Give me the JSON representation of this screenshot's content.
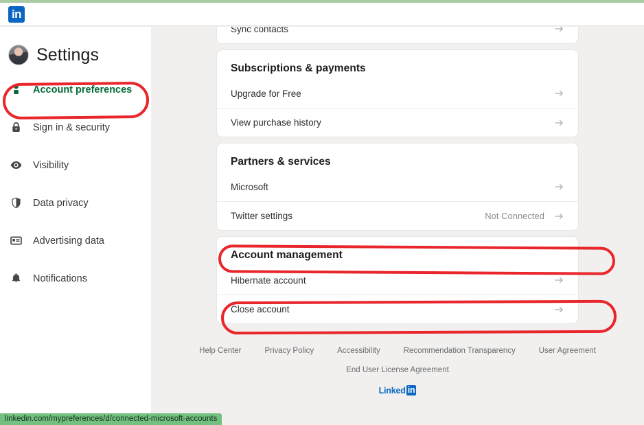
{
  "header": {
    "logo_text": "in",
    "logo_icon": "linkedin-logo-icon"
  },
  "sidebar": {
    "title": "Settings",
    "avatar_name": "user-avatar",
    "items": [
      {
        "label": "Account preferences",
        "icon": "person-icon",
        "active": true
      },
      {
        "label": "Sign in & security",
        "icon": "lock-icon",
        "active": false
      },
      {
        "label": "Visibility",
        "icon": "eye-icon",
        "active": false
      },
      {
        "label": "Data privacy",
        "icon": "shield-icon",
        "active": false
      },
      {
        "label": "Advertising data",
        "icon": "id-card-icon",
        "active": false
      },
      {
        "label": "Notifications",
        "icon": "bell-icon",
        "active": false
      }
    ]
  },
  "main": {
    "cards": [
      {
        "title": "",
        "rows": [
          {
            "label": "Sync contacts",
            "value": "",
            "arrow": true
          }
        ]
      },
      {
        "title": "Subscriptions & payments",
        "rows": [
          {
            "label": "Upgrade for Free",
            "value": "",
            "arrow": true
          },
          {
            "label": "View purchase history",
            "value": "",
            "arrow": true
          }
        ]
      },
      {
        "title": "Partners & services",
        "rows": [
          {
            "label": "Microsoft",
            "value": "",
            "arrow": true
          },
          {
            "label": "Twitter settings",
            "value": "Not Connected",
            "arrow": true
          }
        ]
      },
      {
        "title": "Account management",
        "rows": [
          {
            "label": "Hibernate account",
            "value": "",
            "arrow": true
          },
          {
            "label": "Close account",
            "value": "",
            "arrow": true
          }
        ]
      }
    ]
  },
  "footer": {
    "links_row1": [
      "Help Center",
      "Privacy Policy",
      "Accessibility",
      "Recommendation Transparency",
      "User Agreement"
    ],
    "links_row2": [
      "End User License Agreement"
    ],
    "brand_text": "Linked",
    "brand_badge": "in"
  },
  "status_bar": {
    "url": "linkedin.com/mypreferences/d/connected-microsoft-accounts"
  },
  "colors": {
    "linkedin_blue": "#0a66c2",
    "active_green": "#046a38",
    "annotation_red": "#e8262b",
    "page_background": "#f1f0ee",
    "status_bar_green": "#73c081",
    "top_edge_green": "#a8cba4"
  }
}
